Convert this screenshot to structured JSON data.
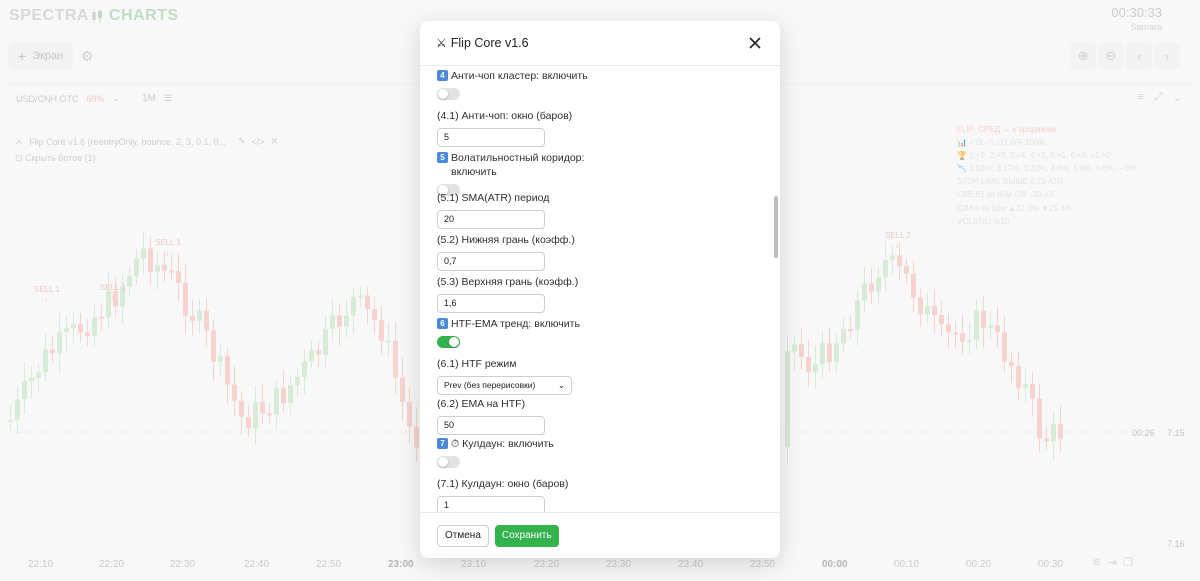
{
  "app": {
    "brand_left": "SPECTRA",
    "brand_right": "CHARTS",
    "clock_time": "00:30:33",
    "clock_city": "Samara",
    "screen_button": "Экран",
    "symbol": "USD/CNH OTC",
    "payout": "69%",
    "timeframe": "1M",
    "bot_line": "Flip Core v1.6 (reentryOnly, bounce, 2, 3, 0.1, 0...",
    "hide_bots": "Скрыть ботов (1)",
    "price_right": "7.15",
    "price_bottom": "7.16",
    "timer_label": "00:26",
    "info_title": "FLIP: СРЕД → к продажам",
    "info_lines": [
      "📊 +18 –0 с1) WR 100%",
      "🏆 1:+9, 2:+3, 3:+4, 4:+1, 5:+1, 6:+0, ≥1 =0",
      "📉 1:50%, 2:17%, 3:22%, 4:6%, 5:6%, 6:0%, – 0%",
      "STOP LINE: ВЫШЕ 0.72 ATR",
      "CBE:61 за 60м ↑28 ↓30 =3",
      "СИЛА за 60м ▲27.0% ▼25.4%",
      "VOLATIL: 4/10"
    ],
    "x_ticks": [
      {
        "t": "22:10",
        "bold": false
      },
      {
        "t": "22:20",
        "bold": false
      },
      {
        "t": "22:30",
        "bold": false
      },
      {
        "t": "22:40",
        "bold": false
      },
      {
        "t": "22:50",
        "bold": false
      },
      {
        "t": "23:00",
        "bold": true
      },
      {
        "t": "23:10",
        "bold": false
      },
      {
        "t": "23:20",
        "bold": false
      },
      {
        "t": "23:30",
        "bold": false
      },
      {
        "t": "23:40",
        "bold": false
      },
      {
        "t": "23:50",
        "bold": false
      },
      {
        "t": "00:00",
        "bold": true
      },
      {
        "t": "00:10",
        "bold": false
      },
      {
        "t": "00:20",
        "bold": false
      },
      {
        "t": "00:30",
        "bold": false
      }
    ],
    "sell_labels": [
      "SELL 1",
      "SELL 1",
      "SELL 1",
      "SELL 2"
    ]
  },
  "modal": {
    "title": "Flip Core v1.6",
    "fields": [
      {
        "kind": "toggle",
        "badge": "4",
        "label": "Анти-чоп кластер: включить",
        "on": false
      },
      {
        "kind": "input",
        "label": "(4.1) Анти-чоп: окно (баров)",
        "value": "5"
      },
      {
        "kind": "toggle",
        "badge": "5",
        "label": "Волатильностный коридор: включить",
        "on": false
      },
      {
        "kind": "input",
        "label": "(5.1) SMA(ATR) период",
        "value": "20"
      },
      {
        "kind": "input",
        "label": "(5.2) Нижняя грань (коэфф.)",
        "value": "0,7"
      },
      {
        "kind": "input",
        "label": "(5.3) Верхняя грань (коэфф.)",
        "value": "1,6"
      },
      {
        "kind": "toggle",
        "badge": "6",
        "label": "HTF-EMA тренд: включить",
        "on": true
      },
      {
        "kind": "select",
        "label": "(6.1) HTF режим",
        "value": "Prev (без перерисовки)"
      },
      {
        "kind": "input",
        "label": "(6.2) EMA на HTF)",
        "value": "50"
      },
      {
        "kind": "toggle",
        "badge": "7",
        "label": "⏱ Кулдаун: включить",
        "on": false
      },
      {
        "kind": "input",
        "label": "(7.1) Кулдаун: окно (баров)",
        "value": "1"
      }
    ],
    "cancel": "Отмена",
    "save": "Сохранить"
  }
}
